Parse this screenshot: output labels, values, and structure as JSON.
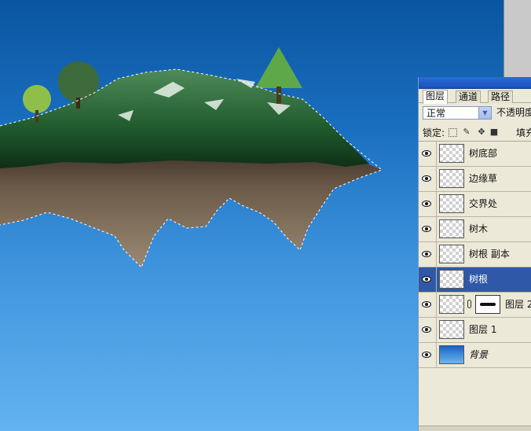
{
  "panel": {
    "tabs": [
      "图层",
      "通道",
      "路径"
    ],
    "active_tab": 0,
    "blend_mode": "正常",
    "opacity_label": "不透明度",
    "lock_label": "锁定:",
    "fill_label": "填充"
  },
  "layers": [
    {
      "name": "树底部",
      "visible": true,
      "selected": false
    },
    {
      "name": "边缘草",
      "visible": true,
      "selected": false
    },
    {
      "name": "交界处",
      "visible": true,
      "selected": false
    },
    {
      "name": "树木",
      "visible": true,
      "selected": false
    },
    {
      "name": "树根 副本",
      "visible": true,
      "selected": false
    },
    {
      "name": "树根",
      "visible": true,
      "selected": true
    },
    {
      "name": "图层 2",
      "visible": true,
      "selected": false,
      "has_mask": true
    },
    {
      "name": "图层 1",
      "visible": true,
      "selected": false
    },
    {
      "name": "背景",
      "visible": true,
      "selected": false,
      "italic": true
    }
  ],
  "colors": {
    "selected_row": "#2f59a8",
    "panel_bg": "#ece9d8",
    "sky_top": "#0a55a0",
    "sky_bottom": "#62b3f0"
  }
}
